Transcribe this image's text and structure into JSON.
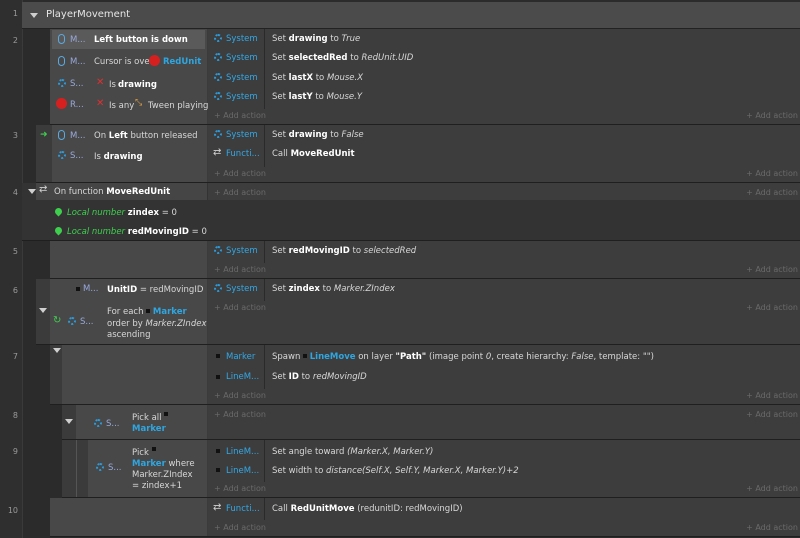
{
  "rows": [
    "1",
    "2",
    "3",
    "4",
    "5",
    "6",
    "7",
    "8",
    "9",
    "10"
  ],
  "group": {
    "title": "PlayerMovement"
  },
  "add_action": "+ Add action",
  "add_short": "+ Add",
  "e2": {
    "c1_obj": "M...",
    "c1_text": "Left button is down",
    "c2_obj": "M...",
    "c2_text": "Cursor is over",
    "c2_target": "RedUnit",
    "c3_obj": "S...",
    "c3_pre": "Is",
    "c3_text": "drawing",
    "c4_obj": "R...",
    "c4_pre": "Is any",
    "c4_text": "Tween playing",
    "actions": [
      {
        "obj": "System",
        "verb": "Set",
        "name": "drawing",
        "mid": "to",
        "val": "True"
      },
      {
        "obj": "System",
        "verb": "Set",
        "name": "selectedRed",
        "mid": "to",
        "val": "RedUnit.UID"
      },
      {
        "obj": "System",
        "verb": "Set",
        "name": "lastX",
        "mid": "to",
        "val": "Mouse.X"
      },
      {
        "obj": "System",
        "verb": "Set",
        "name": "lastY",
        "mid": "to",
        "val": "Mouse.Y"
      }
    ]
  },
  "e3": {
    "c1_obj": "M...",
    "c1_pre": "On",
    "c1_bold": "Left",
    "c1_post": "button released",
    "c2_obj": "S...",
    "c2_pre": "Is",
    "c2_text": "drawing",
    "a1": {
      "obj": "System",
      "verb": "Set",
      "name": "drawing",
      "mid": "to",
      "val": "False"
    },
    "a2": {
      "obj": "Functi...",
      "verb": "Call",
      "name": "MoveRedUnit"
    }
  },
  "e4": {
    "pre": "On function",
    "name": "MoveRedUnit",
    "l1": {
      "kind": "Local number",
      "name": "zindex",
      "eq": "= 0"
    },
    "l2": {
      "kind": "Local number",
      "name": "redMovingID",
      "eq": "= 0"
    }
  },
  "e5": {
    "obj": "System",
    "verb": "Set",
    "name": "redMovingID",
    "mid": "to",
    "val": "selectedRed"
  },
  "e6": {
    "c1_obj": "M...",
    "c1_bold": "UnitID",
    "c1_text": "= redMovingID",
    "c2_obj": "S...",
    "c2_pre": "For each",
    "c2_target": "Marker",
    "c2_l2": "order by",
    "c2_val": "Marker.ZIndex",
    "c2_l3": "ascending",
    "a1": {
      "obj": "System",
      "verb": "Set",
      "name": "zindex",
      "mid": "to",
      "val": "Marker.ZIndex"
    }
  },
  "e7": {
    "a1": {
      "obj": "Marker",
      "verb": "Spawn",
      "target": "LineMove",
      "mid": "on layer",
      "layer": "\"Path\"",
      "p1": "(image point",
      "v1": "0",
      ",": ",",
      "p2": "create hierarchy:",
      "v2": "False",
      "p3": ", template: \"\")"
    },
    "a2": {
      "obj": "LineM...",
      "verb": "Set",
      "name": "ID",
      "mid": "to",
      "val": "redMovingID"
    }
  },
  "e8": {
    "obj": "S...",
    "pre": "Pick all",
    "target": "Marker"
  },
  "e9": {
    "obj": "S...",
    "pre": "Pick",
    "target": "Marker",
    "l2": "where",
    "l3": "Marker.ZIndex",
    "l4": "= zindex+1",
    "a1": {
      "obj": "LineM...",
      "verb": "Set angle toward",
      "val": "(Marker.X, Marker.Y)"
    },
    "a2": {
      "obj": "LineM...",
      "verb": "Set width to",
      "val": "distance(Self.X, Self.Y, Marker.X, Marker.Y)+2"
    }
  },
  "e10": {
    "obj": "Functi...",
    "verb": "Call",
    "name": "RedUnitMove",
    "args": "(redunitID: redMovingID)"
  }
}
